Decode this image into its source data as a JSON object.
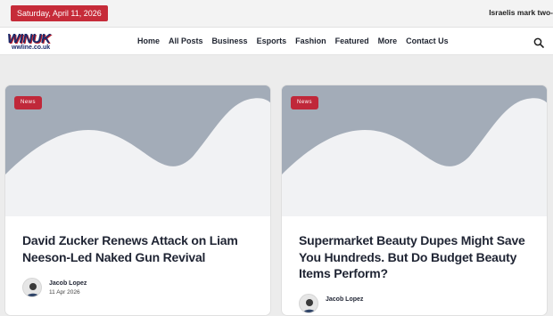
{
  "topbar": {
    "date": "Saturday, April 11, 2026",
    "ticker": "Israelis mark two-"
  },
  "header": {
    "logo_main": "WINUK",
    "logo_sub": "wwline.co.uk",
    "nav": [
      "Home",
      "All Posts",
      "Business",
      "Esports",
      "Fashion",
      "Featured",
      "More",
      "Contact Us"
    ]
  },
  "colors": {
    "accent": "#c62b39",
    "placeholder": "#a3acb8"
  },
  "posts": [
    {
      "category": "News",
      "title": "David Zucker Renews Attack on Liam Neeson-Led Naked Gun Revival",
      "author": "Jacob Lopez",
      "date": "11 Apr 2026"
    },
    {
      "category": "News",
      "title": "Supermarket Beauty Dupes Might Save You Hundreds. But Do Budget Beauty Items Perform?",
      "author": "Jacob Lopez",
      "date": ""
    }
  ]
}
